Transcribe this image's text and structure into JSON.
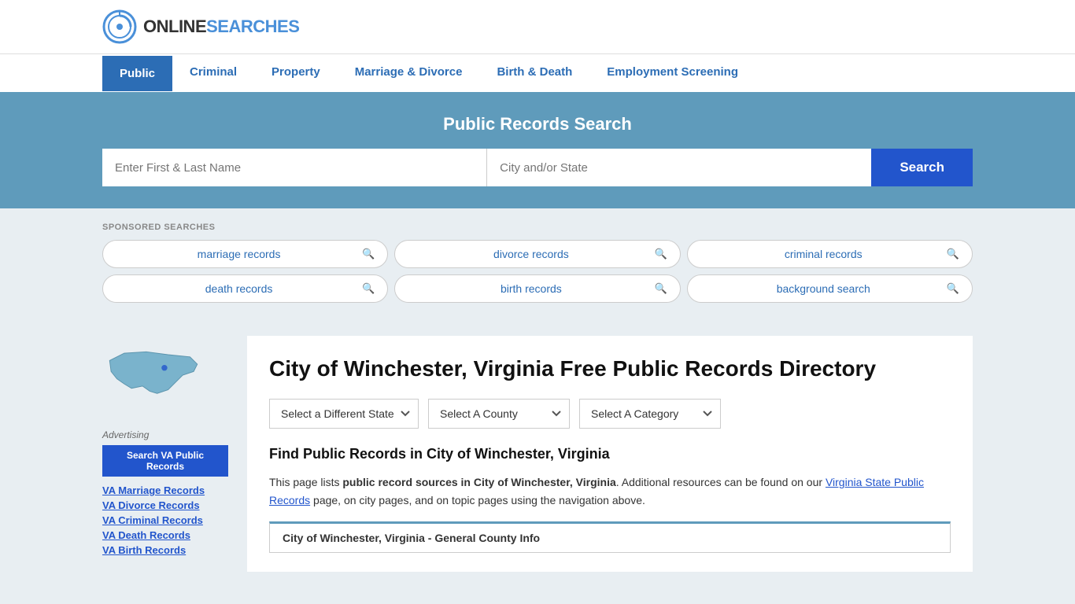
{
  "logo": {
    "text_online": "ONLINE",
    "text_searches": "SEARCHES"
  },
  "nav": {
    "items": [
      {
        "label": "Public",
        "active": true
      },
      {
        "label": "Criminal",
        "active": false
      },
      {
        "label": "Property",
        "active": false
      },
      {
        "label": "Marriage & Divorce",
        "active": false
      },
      {
        "label": "Birth & Death",
        "active": false
      },
      {
        "label": "Employment Screening",
        "active": false
      }
    ]
  },
  "search_hero": {
    "title": "Public Records Search",
    "name_placeholder": "Enter First & Last Name",
    "location_placeholder": "City and/or State",
    "search_button": "Search"
  },
  "sponsored": {
    "label": "SPONSORED SEARCHES",
    "pills": [
      {
        "text": "marriage records"
      },
      {
        "text": "divorce records"
      },
      {
        "text": "criminal records"
      },
      {
        "text": "death records"
      },
      {
        "text": "birth records"
      },
      {
        "text": "background search"
      }
    ]
  },
  "sidebar": {
    "ad_label": "Advertising",
    "ad_button": "Search VA Public Records",
    "links": [
      "VA Marriage Records",
      "VA Divorce Records",
      "VA Criminal Records",
      "VA Death Records",
      "VA Birth Records"
    ]
  },
  "main": {
    "page_title": "City of Winchester, Virginia Free Public Records Directory",
    "dropdowns": {
      "state": "Select a Different State",
      "county": "Select A County",
      "category": "Select A Category"
    },
    "find_records_title": "Find Public Records in City of Winchester, Virginia",
    "find_records_text_1": "This page lists ",
    "find_records_bold_1": "public record sources in City of Winchester, Virginia",
    "find_records_text_2": ". Additional resources can be found on our ",
    "find_records_link": "Virginia State Public Records",
    "find_records_text_3": " page, on city pages, and on topic pages using the navigation above.",
    "county_info_bar": "City of Winchester, Virginia - General County Info"
  }
}
